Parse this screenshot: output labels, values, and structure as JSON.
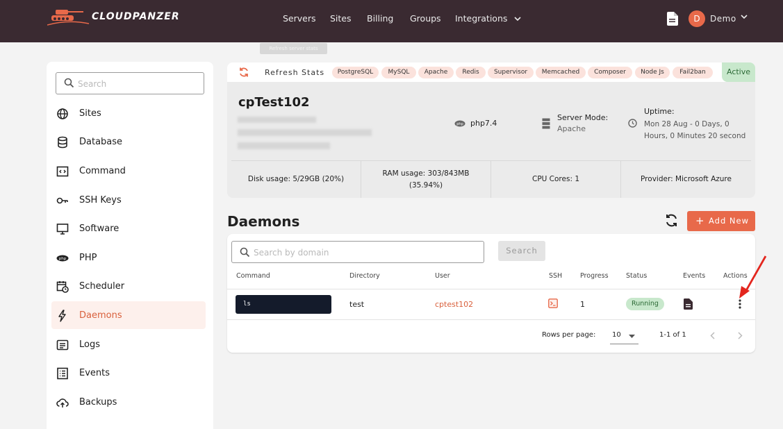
{
  "brand": {
    "name": "CLOUDPANZER"
  },
  "nav": {
    "items": [
      "Servers",
      "Sites",
      "Billing",
      "Groups",
      "Integrations"
    ],
    "user_initial": "D",
    "user_name": "Demo"
  },
  "tooltip": "Refresh server stats",
  "sidebar": {
    "search_placeholder": "Search",
    "items": [
      {
        "label": "Sites",
        "icon": "globe-icon"
      },
      {
        "label": "Database",
        "icon": "database-icon"
      },
      {
        "label": "Command",
        "icon": "code-icon"
      },
      {
        "label": "SSH Keys",
        "icon": "key-icon"
      },
      {
        "label": "Software",
        "icon": "monitor-icon"
      },
      {
        "label": "PHP",
        "icon": "php-icon"
      },
      {
        "label": "Scheduler",
        "icon": "calendar-clock-icon"
      },
      {
        "label": "Daemons",
        "icon": "bolt-icon",
        "active": true
      },
      {
        "label": "Logs",
        "icon": "logs-icon"
      },
      {
        "label": "Events",
        "icon": "list-icon"
      },
      {
        "label": "Backups",
        "icon": "cloud-upload-icon"
      }
    ]
  },
  "stats_bar": {
    "refresh_label": "Refresh Stats",
    "services": [
      "PostgreSQL",
      "MySQL",
      "Apache",
      "Redis",
      "Supervisor",
      "Memcached",
      "Composer",
      "Node Js",
      "Fail2ban"
    ],
    "status": "Active"
  },
  "server": {
    "name": "cpTest102",
    "php": "php7.4",
    "mode_title": "Server Mode:",
    "mode_value": "Apache",
    "uptime_title": "Uptime:",
    "uptime_value": "Mon 28 Aug - 0 Days, 0 Hours, 0 Minutes 20 second",
    "disk": "Disk usage: 5/29GB (20%)",
    "ram_line1": "RAM usage: 303/843MB",
    "ram_line2": "(35.94%)",
    "cpu": "CPU Cores: 1",
    "provider": "Provider: Microsoft Azure"
  },
  "daemons": {
    "title": "Daemons",
    "add_label": "Add New",
    "search_placeholder": "Search by domain",
    "search_button": "Search",
    "columns": [
      "Command",
      "Directory",
      "User",
      "SSH",
      "Progress",
      "Status",
      "Events",
      "Actions"
    ],
    "rows": [
      {
        "command": "ls",
        "directory": "test",
        "user": "cptest102",
        "progress": "1",
        "status": "Running"
      }
    ],
    "rows_per_page_label": "Rows per page:",
    "rows_per_page": "10",
    "range": "1-1 of 1"
  },
  "colors": {
    "topbar": "#3a2a31",
    "accent": "#e8694a",
    "chip": "#fbe2dc",
    "success_bg": "#c8e8cc",
    "command_bg": "#141b2b"
  }
}
